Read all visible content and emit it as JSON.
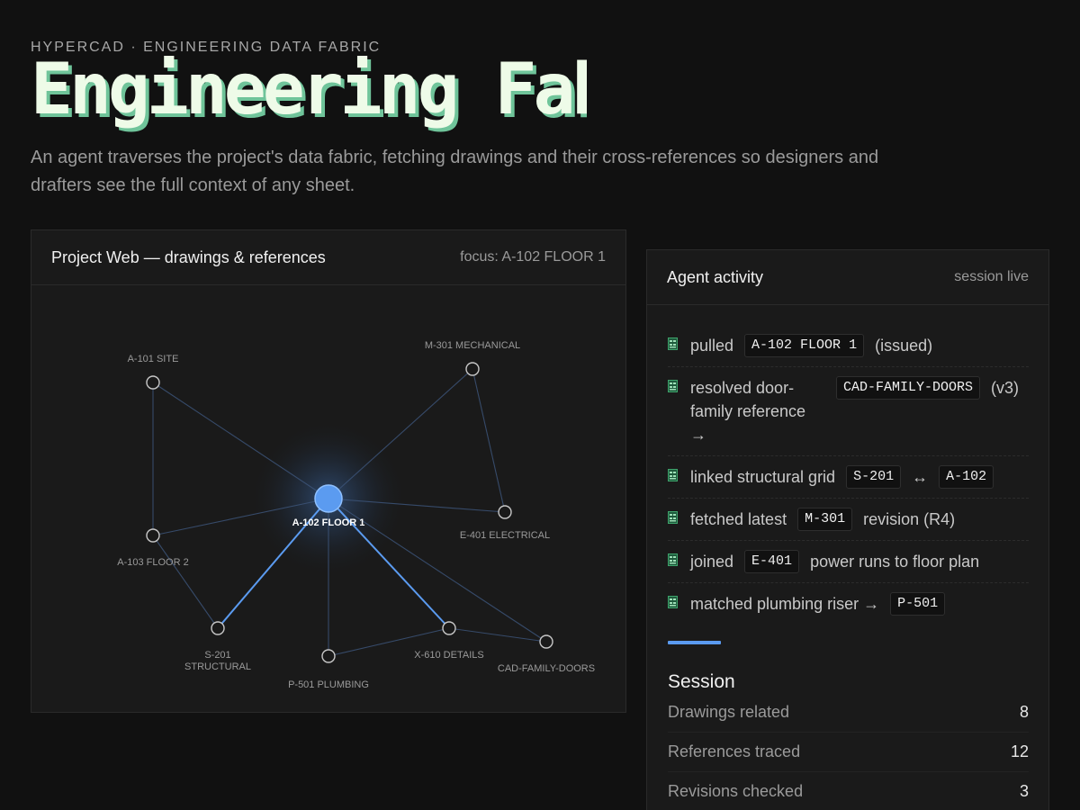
{
  "header": {
    "eyebrow": "HYPERCAD · ENGINEERING DATA FABRIC",
    "title": "Engineering Fabric",
    "subtitle": "An agent traverses the project's data fabric, fetching drawings and their cross-references so designers and drafters see the full context of any sheet."
  },
  "web": {
    "title": "Project Web — drawings & references",
    "focus": "focus: A-102 FLOOR 1",
    "accent": "#5b9bf0",
    "nodes": [
      {
        "id": "A-102",
        "label": [
          "A-102 FLOOR 1"
        ],
        "focus": true
      },
      {
        "id": "A-101",
        "label": [
          "A-101 SITE"
        ]
      },
      {
        "id": "M-301",
        "label": [
          "M-301 MECHANICAL"
        ]
      },
      {
        "id": "E-401",
        "label": [
          "E-401 ELECTRICAL"
        ]
      },
      {
        "id": "A-103",
        "label": [
          "A-103 FLOOR 2"
        ]
      },
      {
        "id": "S-201",
        "label": [
          "S-201",
          "STRUCTURAL"
        ]
      },
      {
        "id": "P-501",
        "label": [
          "P-501 PLUMBING"
        ]
      },
      {
        "id": "X-610",
        "label": [
          "X-610 DETAILS"
        ]
      },
      {
        "id": "CAD",
        "label": [
          "CAD-FAMILY-DOORS"
        ]
      }
    ],
    "edges": [
      [
        "A-102",
        "A-101",
        false
      ],
      [
        "A-102",
        "M-301",
        false
      ],
      [
        "A-102",
        "E-401",
        false
      ],
      [
        "A-102",
        "A-103",
        false
      ],
      [
        "A-102",
        "S-201",
        true
      ],
      [
        "A-102",
        "P-501",
        false
      ],
      [
        "A-102",
        "X-610",
        true
      ],
      [
        "A-102",
        "CAD",
        false
      ],
      [
        "A-101",
        "A-103",
        false
      ],
      [
        "A-103",
        "S-201",
        false
      ],
      [
        "M-301",
        "E-401",
        false
      ],
      [
        "P-501",
        "X-610",
        false
      ],
      [
        "X-610",
        "CAD",
        false
      ]
    ]
  },
  "activity": {
    "title": "Agent activity",
    "status": "session live",
    "items": [
      {
        "parts": [
          {
            "t": "pulled"
          },
          {
            "c": "A-102 FLOOR 1"
          },
          {
            "t": "(issued)"
          }
        ]
      },
      {
        "parts": [
          {
            "t": "resolved door-family reference →"
          },
          {
            "c": "CAD-FAMILY-DOORS"
          },
          {
            "t": "(v3)"
          }
        ]
      },
      {
        "parts": [
          {
            "t": "linked structural grid"
          },
          {
            "c": "S-201"
          },
          {
            "t": "↔"
          },
          {
            "c": "A-102"
          }
        ]
      },
      {
        "parts": [
          {
            "t": "fetched latest"
          },
          {
            "c": "M-301"
          },
          {
            "t": "revision (R4)"
          }
        ]
      },
      {
        "parts": [
          {
            "t": "joined"
          },
          {
            "c": "E-401"
          },
          {
            "t": "power runs to floor plan"
          }
        ]
      },
      {
        "parts": [
          {
            "t": "matched plumbing riser →"
          },
          {
            "c": "P-501"
          }
        ]
      }
    ]
  },
  "session": {
    "title": "Session",
    "stats": [
      {
        "label": "Drawings related",
        "value": "8"
      },
      {
        "label": "References traced",
        "value": "12"
      },
      {
        "label": "Revisions checked",
        "value": "3"
      }
    ]
  }
}
